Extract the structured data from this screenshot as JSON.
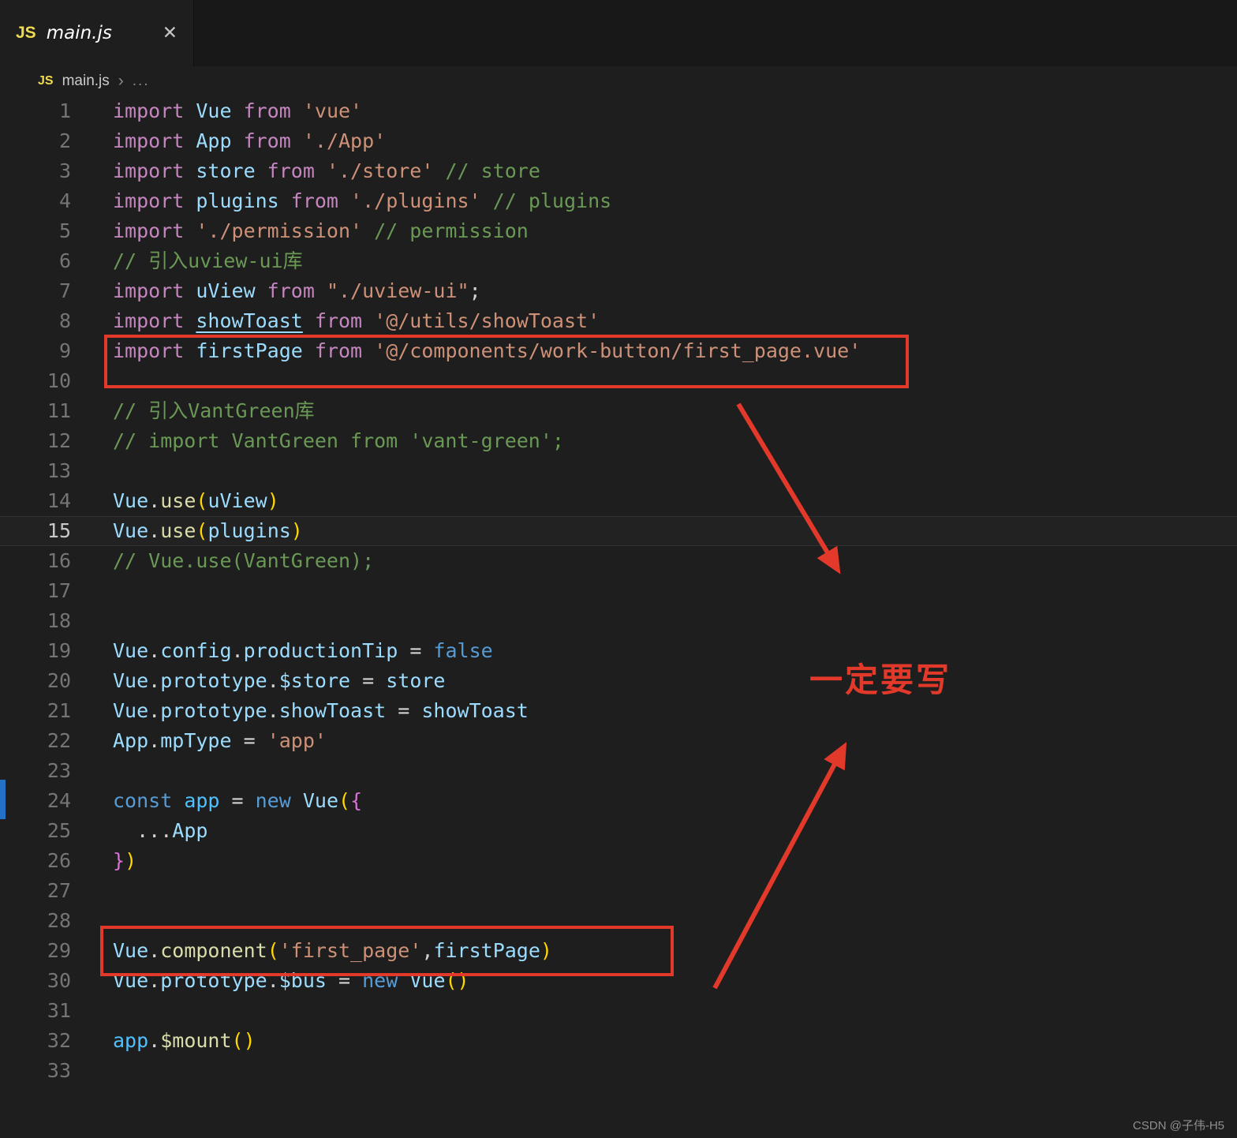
{
  "colors": {
    "editor_bg": "#1E1E1E",
    "tabbar_bg": "#181818",
    "annotation_red": "#E2392B",
    "accent_blue": "#2472C8",
    "js_icon_yellow": "#F0DC4E"
  },
  "tab": {
    "icon": "JS",
    "title": "main.js",
    "close_label": "✕"
  },
  "breadcrumb": {
    "icon": "JS",
    "file": "main.js",
    "separator": "›",
    "ellipsis": "..."
  },
  "annotations": {
    "note_text": "一定要写"
  },
  "watermark": "CSDN @子伟-H5",
  "editor": {
    "current_line": 15,
    "lines": [
      {
        "n": 1,
        "s": [
          [
            "kw",
            "import "
          ],
          [
            "id",
            "Vue "
          ],
          [
            "kw",
            "from "
          ],
          [
            "str",
            "'vue'"
          ]
        ]
      },
      {
        "n": 2,
        "s": [
          [
            "kw",
            "import "
          ],
          [
            "id",
            "App "
          ],
          [
            "kw",
            "from "
          ],
          [
            "str",
            "'./App'"
          ]
        ]
      },
      {
        "n": 3,
        "s": [
          [
            "kw",
            "import "
          ],
          [
            "id",
            "store "
          ],
          [
            "kw",
            "from "
          ],
          [
            "str",
            "'./store'"
          ],
          [
            "cm",
            " // store"
          ]
        ]
      },
      {
        "n": 4,
        "s": [
          [
            "kw",
            "import "
          ],
          [
            "id",
            "plugins "
          ],
          [
            "kw",
            "from "
          ],
          [
            "str",
            "'./plugins'"
          ],
          [
            "cm",
            " // plugins"
          ]
        ]
      },
      {
        "n": 5,
        "s": [
          [
            "kw",
            "import "
          ],
          [
            "str",
            "'./permission'"
          ],
          [
            "cm",
            " // permission"
          ]
        ]
      },
      {
        "n": 6,
        "s": [
          [
            "cm",
            "// 引入uview-ui库"
          ]
        ]
      },
      {
        "n": 7,
        "s": [
          [
            "kw",
            "import "
          ],
          [
            "id",
            "uView "
          ],
          [
            "kw",
            "from "
          ],
          [
            "str",
            "\"./uview-ui\""
          ],
          [
            "pl",
            ";"
          ]
        ]
      },
      {
        "n": 8,
        "s": [
          [
            "kw",
            "import "
          ],
          [
            "idu",
            "showToast"
          ],
          [
            "pl",
            " "
          ],
          [
            "kw",
            "from "
          ],
          [
            "str",
            "'@/utils/showToast'"
          ]
        ]
      },
      {
        "n": 9,
        "s": [
          [
            "kw",
            "import "
          ],
          [
            "id",
            "firstPage "
          ],
          [
            "kw",
            "from "
          ],
          [
            "str",
            "'@/components/work-button/first_page.vue'"
          ]
        ]
      },
      {
        "n": 10,
        "s": []
      },
      {
        "n": 11,
        "s": [
          [
            "cm",
            "// 引入VantGreen库"
          ]
        ]
      },
      {
        "n": 12,
        "s": [
          [
            "cm",
            "// import VantGreen from 'vant-green';"
          ]
        ]
      },
      {
        "n": 13,
        "s": []
      },
      {
        "n": 14,
        "s": [
          [
            "id",
            "Vue"
          ],
          [
            "pl",
            "."
          ],
          [
            "fn",
            "use"
          ],
          [
            "p1",
            "("
          ],
          [
            "id",
            "uView"
          ],
          [
            "p1",
            ")"
          ]
        ]
      },
      {
        "n": 15,
        "s": [
          [
            "id",
            "Vue"
          ],
          [
            "pl",
            "."
          ],
          [
            "fn",
            "use"
          ],
          [
            "p1",
            "("
          ],
          [
            "id",
            "plugins"
          ],
          [
            "p1",
            ")"
          ]
        ]
      },
      {
        "n": 16,
        "s": [
          [
            "cm",
            "// Vue.use(VantGreen);"
          ]
        ]
      },
      {
        "n": 17,
        "s": []
      },
      {
        "n": 18,
        "s": []
      },
      {
        "n": 19,
        "s": [
          [
            "id",
            "Vue"
          ],
          [
            "pl",
            "."
          ],
          [
            "id",
            "config"
          ],
          [
            "pl",
            "."
          ],
          [
            "id",
            "productionTip"
          ],
          [
            "pl",
            " = "
          ],
          [
            "kb",
            "false"
          ]
        ]
      },
      {
        "n": 20,
        "s": [
          [
            "id",
            "Vue"
          ],
          [
            "pl",
            "."
          ],
          [
            "id",
            "prototype"
          ],
          [
            "pl",
            "."
          ],
          [
            "id",
            "$store"
          ],
          [
            "pl",
            " = "
          ],
          [
            "id",
            "store"
          ]
        ]
      },
      {
        "n": 21,
        "s": [
          [
            "id",
            "Vue"
          ],
          [
            "pl",
            "."
          ],
          [
            "id",
            "prototype"
          ],
          [
            "pl",
            "."
          ],
          [
            "id",
            "showToast"
          ],
          [
            "pl",
            " = "
          ],
          [
            "id",
            "showToast"
          ]
        ]
      },
      {
        "n": 22,
        "s": [
          [
            "id",
            "App"
          ],
          [
            "pl",
            "."
          ],
          [
            "id",
            "mpType"
          ],
          [
            "pl",
            " = "
          ],
          [
            "str",
            "'app'"
          ]
        ]
      },
      {
        "n": 23,
        "s": []
      },
      {
        "n": 24,
        "s": [
          [
            "kb",
            "const "
          ],
          [
            "idc",
            "app"
          ],
          [
            "pl",
            " = "
          ],
          [
            "kb",
            "new "
          ],
          [
            "id",
            "Vue"
          ],
          [
            "p1",
            "("
          ],
          [
            "p2",
            "{"
          ]
        ]
      },
      {
        "n": 25,
        "s": [
          [
            "pl",
            "  ..."
          ],
          [
            "id",
            "App"
          ]
        ]
      },
      {
        "n": 26,
        "s": [
          [
            "p2",
            "}"
          ],
          [
            "p1",
            ")"
          ]
        ]
      },
      {
        "n": 27,
        "s": []
      },
      {
        "n": 28,
        "s": []
      },
      {
        "n": 29,
        "s": [
          [
            "id",
            "Vue"
          ],
          [
            "pl",
            "."
          ],
          [
            "fn",
            "component"
          ],
          [
            "p1",
            "("
          ],
          [
            "str",
            "'first_page'"
          ],
          [
            "pl",
            ","
          ],
          [
            "id",
            "firstPage"
          ],
          [
            "p1",
            ")"
          ]
        ]
      },
      {
        "n": 30,
        "s": [
          [
            "id",
            "Vue"
          ],
          [
            "pl",
            "."
          ],
          [
            "id",
            "prototype"
          ],
          [
            "pl",
            "."
          ],
          [
            "id",
            "$bus"
          ],
          [
            "pl",
            " = "
          ],
          [
            "kb",
            "new "
          ],
          [
            "id",
            "Vue"
          ],
          [
            "p1",
            "()"
          ]
        ]
      },
      {
        "n": 31,
        "s": []
      },
      {
        "n": 32,
        "s": [
          [
            "idc",
            "app"
          ],
          [
            "pl",
            "."
          ],
          [
            "fn",
            "$mount"
          ],
          [
            "p1",
            "()"
          ]
        ]
      },
      {
        "n": 33,
        "s": []
      }
    ]
  }
}
